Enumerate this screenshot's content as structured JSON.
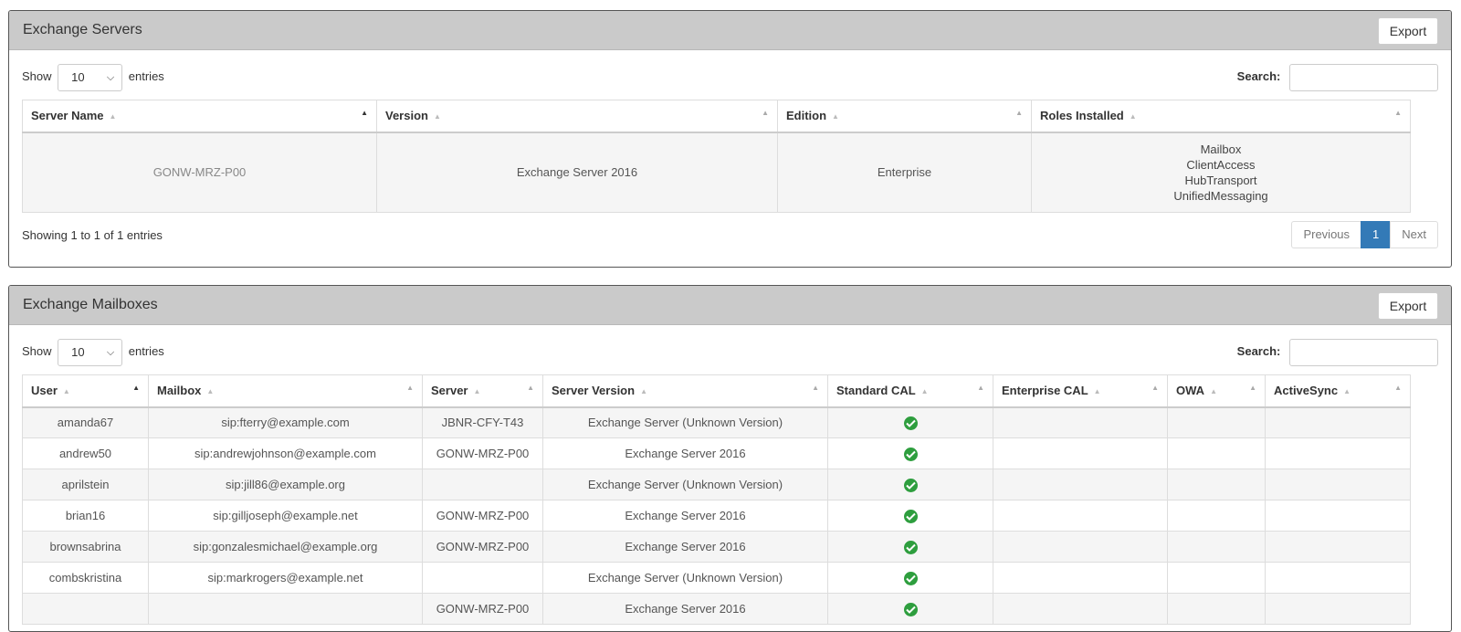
{
  "servers_panel": {
    "title": "Exchange Servers",
    "export_label": "Export",
    "show_label": "Show",
    "entries_label": "entries",
    "page_length": "10",
    "search_label": "Search:",
    "columns": [
      "Server Name",
      "Version",
      "Edition",
      "Roles Installed"
    ],
    "rows": [
      {
        "server_name": "GONW-MRZ-P00",
        "version": "Exchange Server 2016",
        "edition": "Enterprise",
        "roles": [
          "Mailbox",
          "ClientAccess",
          "HubTransport",
          "UnifiedMessaging"
        ]
      }
    ],
    "info": "Showing 1 to 1 of 1 entries",
    "pager": {
      "previous": "Previous",
      "current": "1",
      "next": "Next"
    }
  },
  "mailboxes_panel": {
    "title": "Exchange Mailboxes",
    "export_label": "Export",
    "show_label": "Show",
    "entries_label": "entries",
    "page_length": "10",
    "search_label": "Search:",
    "columns": [
      "User",
      "Mailbox",
      "Server",
      "Server Version",
      "Standard CAL",
      "Enterprise CAL",
      "OWA",
      "ActiveSync"
    ],
    "rows": [
      {
        "user": "amanda67",
        "mailbox": "sip:fterry@example.com",
        "server": "JBNR-CFY-T43",
        "server_version": "Exchange Server (Unknown Version)",
        "standard_cal": true,
        "enterprise_cal": "",
        "owa": "",
        "activesync": ""
      },
      {
        "user": "andrew50",
        "mailbox": "sip:andrewjohnson@example.com",
        "server": "GONW-MRZ-P00",
        "server_version": "Exchange Server 2016",
        "standard_cal": true,
        "enterprise_cal": "",
        "owa": "",
        "activesync": ""
      },
      {
        "user": "aprilstein",
        "mailbox": "sip:jill86@example.org",
        "server": "",
        "server_version": "Exchange Server (Unknown Version)",
        "standard_cal": true,
        "enterprise_cal": "",
        "owa": "",
        "activesync": ""
      },
      {
        "user": "brian16",
        "mailbox": "sip:gilljoseph@example.net",
        "server": "GONW-MRZ-P00",
        "server_version": "Exchange Server 2016",
        "standard_cal": true,
        "enterprise_cal": "",
        "owa": "",
        "activesync": ""
      },
      {
        "user": "brownsabrina",
        "mailbox": "sip:gonzalesmichael@example.org",
        "server": "GONW-MRZ-P00",
        "server_version": "Exchange Server 2016",
        "standard_cal": true,
        "enterprise_cal": "",
        "owa": "",
        "activesync": ""
      },
      {
        "user": "combskristina",
        "mailbox": "sip:markrogers@example.net",
        "server": "",
        "server_version": "Exchange Server (Unknown Version)",
        "standard_cal": true,
        "enterprise_cal": "",
        "owa": "",
        "activesync": ""
      },
      {
        "user": "",
        "mailbox": "",
        "server": "GONW-MRZ-P00",
        "server_version": "Exchange Server 2016",
        "standard_cal": true,
        "enterprise_cal": "",
        "owa": "",
        "activesync": ""
      }
    ]
  },
  "colors": {
    "panel_header": "#cacaca",
    "pager_active": "#337ab7",
    "check_green": "#2e9e3e"
  },
  "icons": {
    "sort": "sort-icon",
    "check": "check-circle-icon",
    "dropdown": "chevron-down-icon"
  }
}
